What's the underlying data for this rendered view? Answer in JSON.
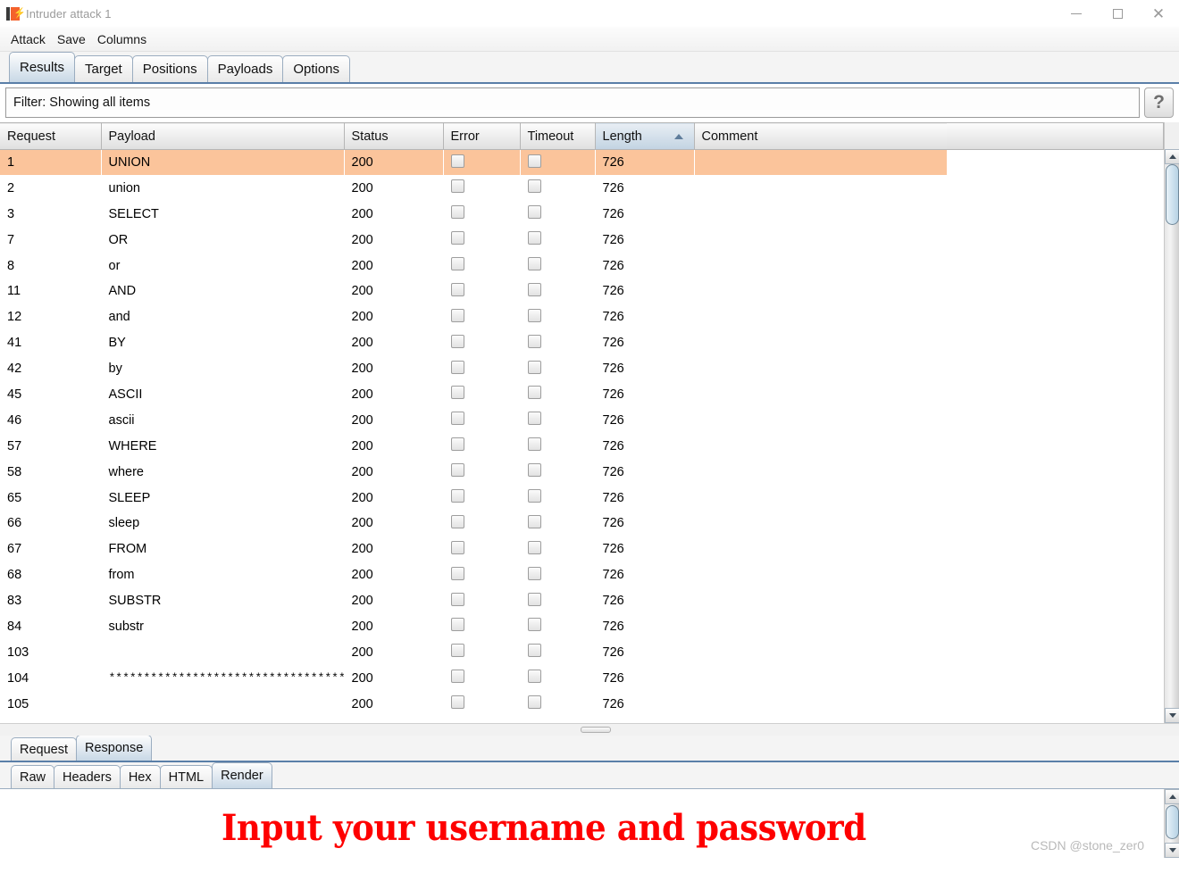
{
  "window": {
    "title": "Intruder attack 1",
    "icon": "burp-suite-icon",
    "minimize_label": "Minimize",
    "maximize_label": "Maximize",
    "close_label": "Close"
  },
  "menubar": {
    "items": [
      {
        "label": "Attack"
      },
      {
        "label": "Save"
      },
      {
        "label": "Columns"
      }
    ]
  },
  "main_tabs": {
    "selected": "Results",
    "items": [
      {
        "label": "Results"
      },
      {
        "label": "Target"
      },
      {
        "label": "Positions"
      },
      {
        "label": "Payloads"
      },
      {
        "label": "Options"
      }
    ]
  },
  "filter": {
    "text": "Filter: Showing all items",
    "help_label": "?"
  },
  "table": {
    "sort_column": "Length",
    "sort_direction": "ascending",
    "columns": [
      {
        "label": "Request"
      },
      {
        "label": "Payload"
      },
      {
        "label": "Status"
      },
      {
        "label": "Error"
      },
      {
        "label": "Timeout"
      },
      {
        "label": "Length"
      },
      {
        "label": "Comment"
      }
    ],
    "rows": [
      {
        "request": "1",
        "payload": "UNION",
        "status": "200",
        "error": false,
        "timeout": false,
        "length": "726",
        "comment": "",
        "selected": true
      },
      {
        "request": "2",
        "payload": "union",
        "status": "200",
        "error": false,
        "timeout": false,
        "length": "726",
        "comment": "",
        "selected": false
      },
      {
        "request": "3",
        "payload": "SELECT",
        "status": "200",
        "error": false,
        "timeout": false,
        "length": "726",
        "comment": "",
        "selected": false
      },
      {
        "request": "7",
        "payload": "OR",
        "status": "200",
        "error": false,
        "timeout": false,
        "length": "726",
        "comment": "",
        "selected": false
      },
      {
        "request": "8",
        "payload": "or",
        "status": "200",
        "error": false,
        "timeout": false,
        "length": "726",
        "comment": "",
        "selected": false
      },
      {
        "request": "11",
        "payload": "AND",
        "status": "200",
        "error": false,
        "timeout": false,
        "length": "726",
        "comment": "",
        "selected": false
      },
      {
        "request": "12",
        "payload": "and",
        "status": "200",
        "error": false,
        "timeout": false,
        "length": "726",
        "comment": "",
        "selected": false
      },
      {
        "request": "41",
        "payload": "BY",
        "status": "200",
        "error": false,
        "timeout": false,
        "length": "726",
        "comment": "",
        "selected": false
      },
      {
        "request": "42",
        "payload": "by",
        "status": "200",
        "error": false,
        "timeout": false,
        "length": "726",
        "comment": "",
        "selected": false
      },
      {
        "request": "45",
        "payload": "ASCII",
        "status": "200",
        "error": false,
        "timeout": false,
        "length": "726",
        "comment": "",
        "selected": false
      },
      {
        "request": "46",
        "payload": "ascii",
        "status": "200",
        "error": false,
        "timeout": false,
        "length": "726",
        "comment": "",
        "selected": false
      },
      {
        "request": "57",
        "payload": "WHERE",
        "status": "200",
        "error": false,
        "timeout": false,
        "length": "726",
        "comment": "",
        "selected": false
      },
      {
        "request": "58",
        "payload": "where",
        "status": "200",
        "error": false,
        "timeout": false,
        "length": "726",
        "comment": "",
        "selected": false
      },
      {
        "request": "65",
        "payload": "SLEEP",
        "status": "200",
        "error": false,
        "timeout": false,
        "length": "726",
        "comment": "",
        "selected": false
      },
      {
        "request": "66",
        "payload": "sleep",
        "status": "200",
        "error": false,
        "timeout": false,
        "length": "726",
        "comment": "",
        "selected": false
      },
      {
        "request": "67",
        "payload": "FROM",
        "status": "200",
        "error": false,
        "timeout": false,
        "length": "726",
        "comment": "",
        "selected": false
      },
      {
        "request": "68",
        "payload": "from",
        "status": "200",
        "error": false,
        "timeout": false,
        "length": "726",
        "comment": "",
        "selected": false
      },
      {
        "request": "83",
        "payload": "SUBSTR",
        "status": "200",
        "error": false,
        "timeout": false,
        "length": "726",
        "comment": "",
        "selected": false
      },
      {
        "request": "84",
        "payload": "substr",
        "status": "200",
        "error": false,
        "timeout": false,
        "length": "726",
        "comment": "",
        "selected": false
      },
      {
        "request": "103",
        "payload": "",
        "status": "200",
        "error": false,
        "timeout": false,
        "length": "726",
        "comment": "",
        "selected": false
      },
      {
        "request": "104",
        "payload": "**************************************** …",
        "status": "200",
        "error": false,
        "timeout": false,
        "length": "726",
        "comment": "",
        "selected": false
      },
      {
        "request": "105",
        "payload": "",
        "status": "200",
        "error": false,
        "timeout": false,
        "length": "726",
        "comment": "",
        "selected": false
      }
    ]
  },
  "message_tabs": {
    "selected": "Response",
    "items": [
      {
        "label": "Request"
      },
      {
        "label": "Response"
      }
    ]
  },
  "view_tabs": {
    "selected": "Render",
    "items": [
      {
        "label": "Raw"
      },
      {
        "label": "Headers"
      },
      {
        "label": "Hex"
      },
      {
        "label": "HTML"
      },
      {
        "label": "Render"
      }
    ]
  },
  "render": {
    "text": "Input your username and password",
    "text_color": "#fe0000"
  },
  "watermark": {
    "text": "CSDN @stone_zer0"
  },
  "colors": {
    "selected_row": "#fbc49b",
    "tab_selected": "#c8d8e6",
    "accent_border": "#5a7fa8"
  }
}
